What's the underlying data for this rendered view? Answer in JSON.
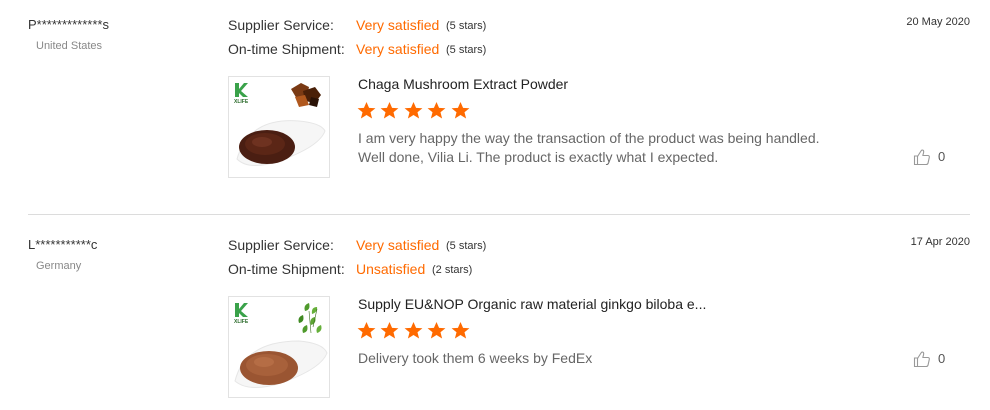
{
  "reviews": [
    {
      "user": "P*************s",
      "country": "United States",
      "date": "20 May 2020",
      "supplier_service": {
        "label": "Supplier Service:",
        "value": "Very satisfied",
        "stars_text": "(5 stars)"
      },
      "ontime_shipment": {
        "label": "On-time Shipment:",
        "value": "Very satisfied",
        "stars_text": "(5 stars)"
      },
      "product_title": "Chaga Mushroom Extract Powder",
      "rating": 5,
      "comment_line1": "I am very happy the way the transaction of the product was being handled.",
      "comment_line2": "Well done, Vilia Li. The product is exactly what I expected.",
      "likes": "0",
      "thumb_brand": "XLIFE"
    },
    {
      "user": "L***********c",
      "country": "Germany",
      "date": "17 Apr 2020",
      "supplier_service": {
        "label": "Supplier Service:",
        "value": "Very satisfied",
        "stars_text": "(5 stars)"
      },
      "ontime_shipment": {
        "label": "On-time Shipment:",
        "value": "Unsatisfied",
        "stars_text": "(2 stars)"
      },
      "product_title": "Supply EU&NOP Organic raw material ginkgo biloba e...",
      "rating": 5,
      "comment_line1": "Delivery took them 6 weeks by FedEx",
      "comment_line2": "",
      "likes": "0",
      "thumb_brand": "XLIFE"
    }
  ],
  "colors": {
    "accent": "#ff6a00",
    "star": "#ff6a00",
    "divider": "#dcdcdc"
  },
  "icons": {
    "star": "star-icon",
    "like": "thumbs-up-icon"
  }
}
